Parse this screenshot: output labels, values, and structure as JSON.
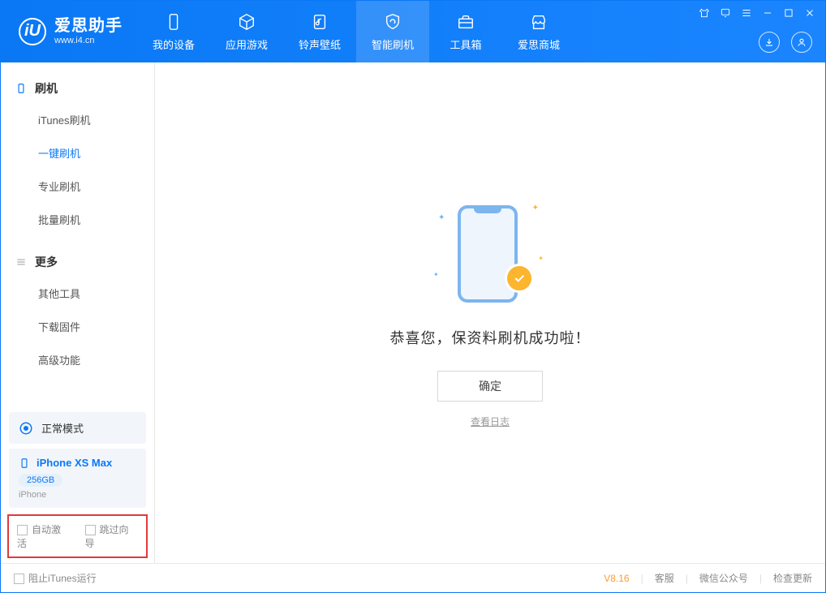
{
  "app": {
    "name": "爱思助手",
    "url": "www.i4.cn",
    "logo_letter": "iU"
  },
  "header_tabs": [
    "我的设备",
    "应用游戏",
    "铃声壁纸",
    "智能刷机",
    "工具箱",
    "爱思商城"
  ],
  "active_tab_index": 3,
  "sidebar": {
    "section1": {
      "title": "刷机",
      "items": [
        "iTunes刷机",
        "一键刷机",
        "专业刷机",
        "批量刷机"
      ],
      "active_index": 1
    },
    "section2": {
      "title": "更多",
      "items": [
        "其他工具",
        "下载固件",
        "高级功能"
      ]
    }
  },
  "mode": {
    "label": "正常模式"
  },
  "device": {
    "name": "iPhone XS Max",
    "storage": "256GB",
    "type": "iPhone"
  },
  "options": {
    "opt1": "自动激活",
    "opt2": "跳过向导"
  },
  "main": {
    "success_text": "恭喜您，保资料刷机成功啦！",
    "ok_button": "确定",
    "view_log": "查看日志"
  },
  "statusbar": {
    "block_itunes": "阻止iTunes运行",
    "version": "V8.16",
    "links": [
      "客服",
      "微信公众号",
      "检查更新"
    ]
  }
}
